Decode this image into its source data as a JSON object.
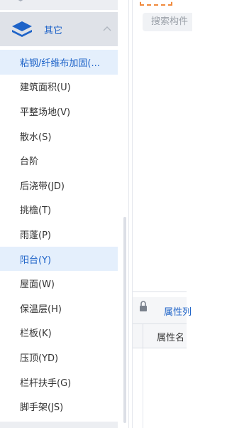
{
  "colors": {
    "accent": "#1e63c8",
    "selected_bg": "#e4effc",
    "group_bg": "#dfe2e8",
    "dashed_border": "#f08a3e"
  },
  "tree": {
    "group": {
      "label": "其它",
      "icon": "layers-icon",
      "expand_icon": "chevron-up-icon"
    },
    "items": [
      {
        "label": "粘钢/纤维布加固(...",
        "state": "selected-highlight"
      },
      {
        "label": "建筑面积(U)",
        "state": "normal"
      },
      {
        "label": "平整场地(V)",
        "state": "normal"
      },
      {
        "label": "散水(S)",
        "state": "normal"
      },
      {
        "label": "台阶",
        "state": "normal"
      },
      {
        "label": "后浇带(JD)",
        "state": "normal"
      },
      {
        "label": "挑檐(T)",
        "state": "normal"
      },
      {
        "label": "雨蓬(P)",
        "state": "normal"
      },
      {
        "label": "阳台(Y)",
        "state": "selected-highlight"
      },
      {
        "label": "屋面(W)",
        "state": "normal"
      },
      {
        "label": "保温层(H)",
        "state": "normal"
      },
      {
        "label": "栏板(K)",
        "state": "normal"
      },
      {
        "label": "压顶(YD)",
        "state": "normal"
      },
      {
        "label": "栏杆扶手(G)",
        "state": "normal"
      },
      {
        "label": "脚手架(JS)",
        "state": "normal"
      }
    ]
  },
  "right": {
    "search_placeholder": "搜索构件",
    "lock_icon": "lock-icon",
    "prop_tab": "属性列",
    "prop_col": "属性名"
  }
}
